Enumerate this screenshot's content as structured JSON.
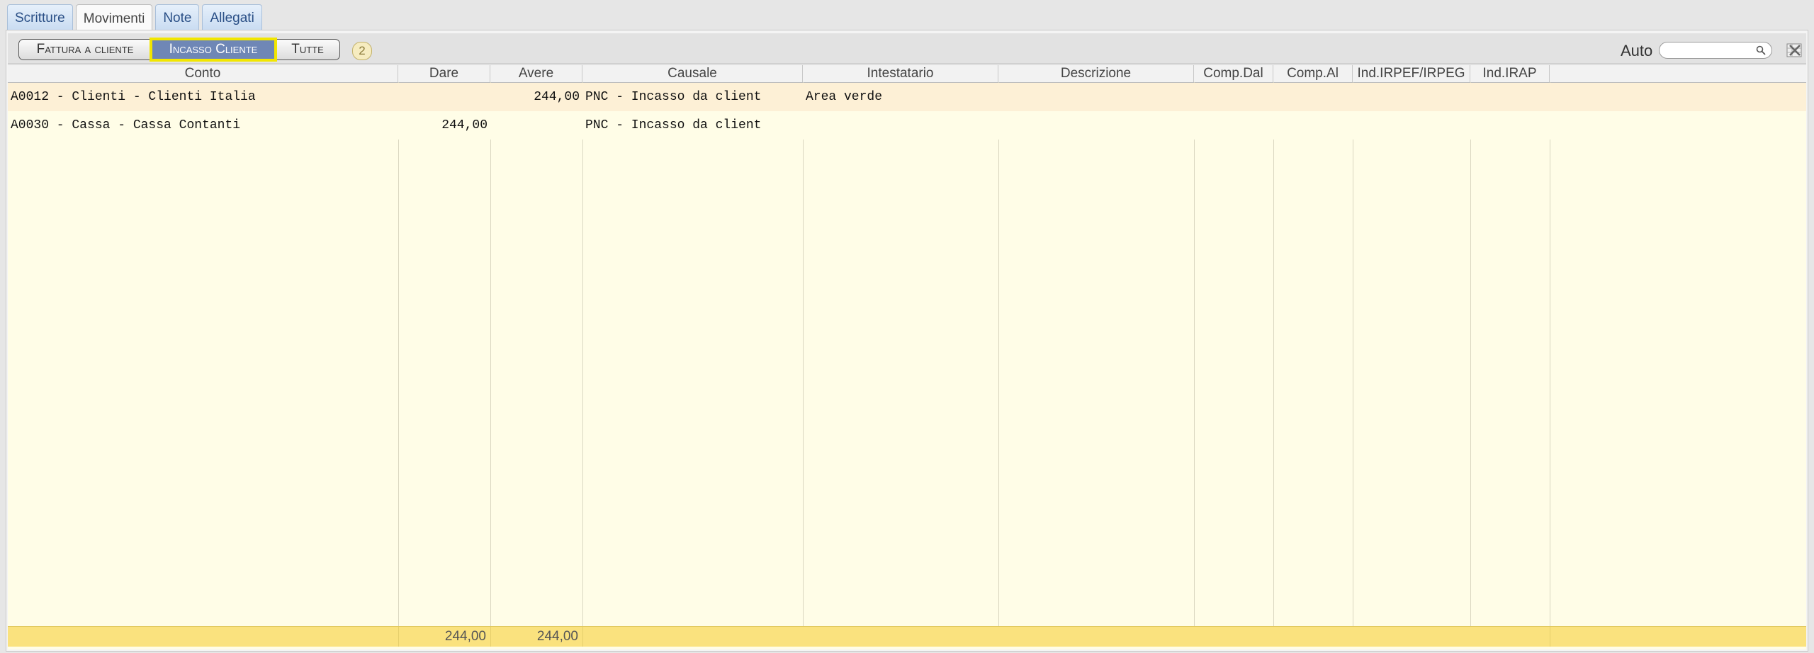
{
  "tabs": [
    {
      "label": "Scritture"
    },
    {
      "label": "Movimenti"
    },
    {
      "label": "Note"
    },
    {
      "label": "Allegati"
    }
  ],
  "toolbar": {
    "filters": [
      {
        "label": "Fattura a cliente"
      },
      {
        "label": "Incasso Cliente"
      },
      {
        "label": "Tutte"
      }
    ],
    "count": "2",
    "auto_label": "Auto",
    "search_value": ""
  },
  "table": {
    "columns": [
      "Conto",
      "Dare",
      "Avere",
      "Causale",
      "Intestatario",
      "Descrizione",
      "Comp.Dal",
      "Comp.Al",
      "Ind.IRPEF/IRPEG",
      "Ind.IRAP"
    ],
    "rows": [
      {
        "conto": "A0012 - Clienti - Clienti Italia",
        "dare": "",
        "avere": "244,00",
        "causale": "PNC - Incasso da client",
        "intestatario": "Area verde"
      },
      {
        "conto": "A0030 - Cassa - Cassa Contanti",
        "dare": "244,00",
        "avere": "",
        "causale": "PNC - Incasso da client",
        "intestatario": ""
      }
    ],
    "totals": {
      "dare": "244,00",
      "avere": "244,00"
    }
  }
}
